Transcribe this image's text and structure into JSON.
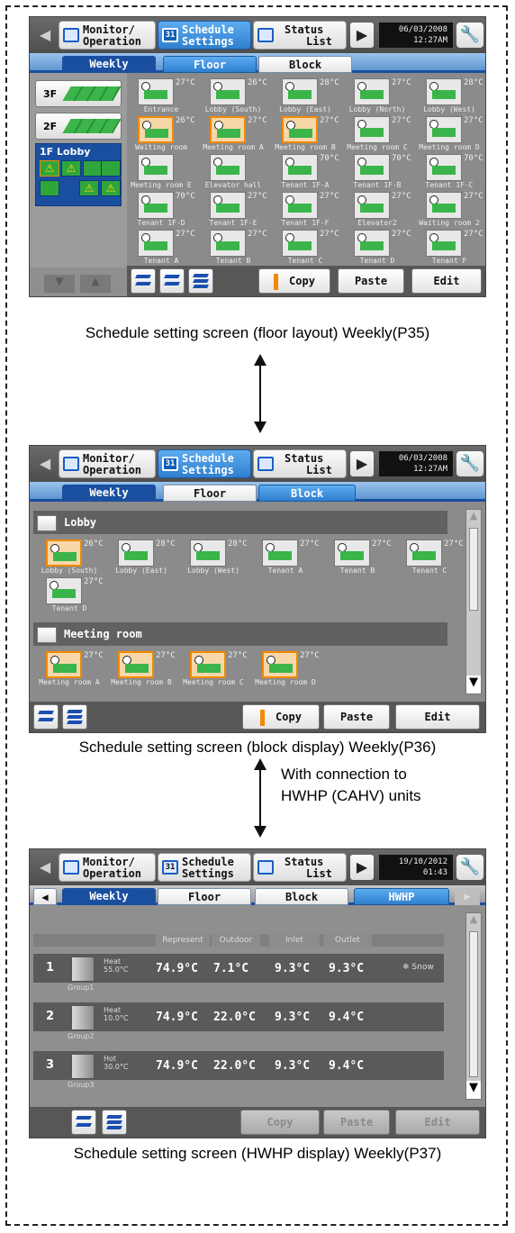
{
  "screen_common": {
    "monitor_line1": "Monitor/",
    "monitor_line2": "Operation",
    "schedule_line1": "Schedule",
    "schedule_line2": "Settings",
    "calendar_day": "31",
    "status_line1": "Status",
    "status_line2": "List"
  },
  "screen1": {
    "date": "06/03/2008",
    "time": "12:27AM",
    "tabs": [
      "Weekly",
      "Floor",
      "Block"
    ],
    "floors": [
      {
        "label": "3F"
      },
      {
        "label": "2F"
      },
      {
        "label": "1F Lobby"
      }
    ],
    "devices": [
      {
        "name": "Entrance",
        "temp": "27°C",
        "selected": false
      },
      {
        "name": "Lobby (South)",
        "temp": "26°C",
        "selected": false
      },
      {
        "name": "Lobby (East)",
        "temp": "28°C",
        "selected": false
      },
      {
        "name": "Lobby (North)",
        "temp": "27°C",
        "selected": false
      },
      {
        "name": "Lobby (West)",
        "temp": "28°C",
        "selected": false
      },
      {
        "name": "Waiting room",
        "temp": "26°C",
        "selected": true
      },
      {
        "name": "Meeting room A",
        "temp": "27°C",
        "selected": true
      },
      {
        "name": "Meeting room B",
        "temp": "27°C",
        "selected": true
      },
      {
        "name": "Meeting room C",
        "temp": "27°C",
        "selected": false
      },
      {
        "name": "Meeting room D",
        "temp": "27°C",
        "selected": false
      },
      {
        "name": "Meeting room E",
        "temp": "",
        "selected": false
      },
      {
        "name": "Elevator hall",
        "temp": "",
        "selected": false
      },
      {
        "name": "Tenant 1F-A",
        "temp": "70°C",
        "selected": false
      },
      {
        "name": "Tenant 1F-B",
        "temp": "70°C",
        "selected": false
      },
      {
        "name": "Tenant 1F-C",
        "temp": "70°C",
        "selected": false
      },
      {
        "name": "Tenant 1F-D",
        "temp": "70°C",
        "selected": false
      },
      {
        "name": "Tenant 1F-E",
        "temp": "27°C",
        "selected": false
      },
      {
        "name": "Tenant 1F-F",
        "temp": "27°C",
        "selected": false
      },
      {
        "name": "Elevator2",
        "temp": "27°C",
        "selected": false
      },
      {
        "name": "Waiting room 2",
        "temp": "27°C",
        "selected": false
      },
      {
        "name": "Tenant A",
        "temp": "27°C",
        "selected": false
      },
      {
        "name": "Tenant B",
        "temp": "27°C",
        "selected": false
      },
      {
        "name": "Tenant C",
        "temp": "27°C",
        "selected": false
      },
      {
        "name": "Tenant D",
        "temp": "27°C",
        "selected": false
      },
      {
        "name": "Tenant F",
        "temp": "27°C",
        "selected": false
      }
    ],
    "copy": "Copy",
    "paste": "Paste",
    "edit": "Edit",
    "caption": "Schedule setting screen (floor layout) Weekly(P35)"
  },
  "screen2": {
    "date": "06/03/2008",
    "time": "12:27AM",
    "tabs": [
      "Weekly",
      "Floor",
      "Block"
    ],
    "lobby_title": "Lobby",
    "lobby_devices": [
      {
        "name": "Lobby (South)",
        "temp": "26°C",
        "selected": true
      },
      {
        "name": "Lobby (East)",
        "temp": "28°C",
        "selected": false
      },
      {
        "name": "Lobby (West)",
        "temp": "28°C",
        "selected": false
      },
      {
        "name": "Tenant A",
        "temp": "27°C",
        "selected": false
      },
      {
        "name": "Tenant B",
        "temp": "27°C",
        "selected": false
      },
      {
        "name": "Tenant C",
        "temp": "27°C",
        "selected": false
      },
      {
        "name": "Tenant D",
        "temp": "27°C",
        "selected": false
      }
    ],
    "meeting_title": "Meeting room",
    "meeting_devices": [
      {
        "name": "Meeting room A",
        "temp": "27°C",
        "selected": true
      },
      {
        "name": "Meeting room B",
        "temp": "27°C",
        "selected": true
      },
      {
        "name": "Meeting room C",
        "temp": "27°C",
        "selected": true
      },
      {
        "name": "Meeting room D",
        "temp": "27°C",
        "selected": true
      }
    ],
    "copy": "Copy",
    "paste": "Paste",
    "edit": "Edit",
    "caption": "Schedule setting screen (block display) Weekly(P36)"
  },
  "connection_note_line1": "With connection to",
  "connection_note_line2": "HWHP (CAHV) units",
  "screen3": {
    "date": "19/10/2012",
    "time": "01:43",
    "tabs": [
      "Weekly",
      "Floor",
      "Block",
      "HWHP"
    ],
    "headers": [
      "Represent",
      "Outdoor",
      "Inlet",
      "Outlet"
    ],
    "rows": [
      {
        "num": "1",
        "mode": "Heat",
        "set": "55.0°C",
        "represent": "74.9°C",
        "outdoor": "7.1°C",
        "inlet": "9.3°C",
        "outlet": "9.3°C",
        "group": "Group1",
        "extra": "Snow"
      },
      {
        "num": "2",
        "mode": "Heat",
        "set": "10.0°C",
        "represent": "74.9°C",
        "outdoor": "22.0°C",
        "inlet": "9.3°C",
        "outlet": "9.4°C",
        "group": "Group2",
        "extra": ""
      },
      {
        "num": "3",
        "mode": "Hot",
        "set": "30.0°C",
        "represent": "74.9°C",
        "outdoor": "22.0°C",
        "inlet": "9.3°C",
        "outlet": "9.4°C",
        "group": "Group3",
        "extra": ""
      }
    ],
    "copy": "Copy",
    "paste": "Paste",
    "edit": "Edit",
    "caption": "Schedule setting screen (HWHP display) Weekly(P37)"
  }
}
